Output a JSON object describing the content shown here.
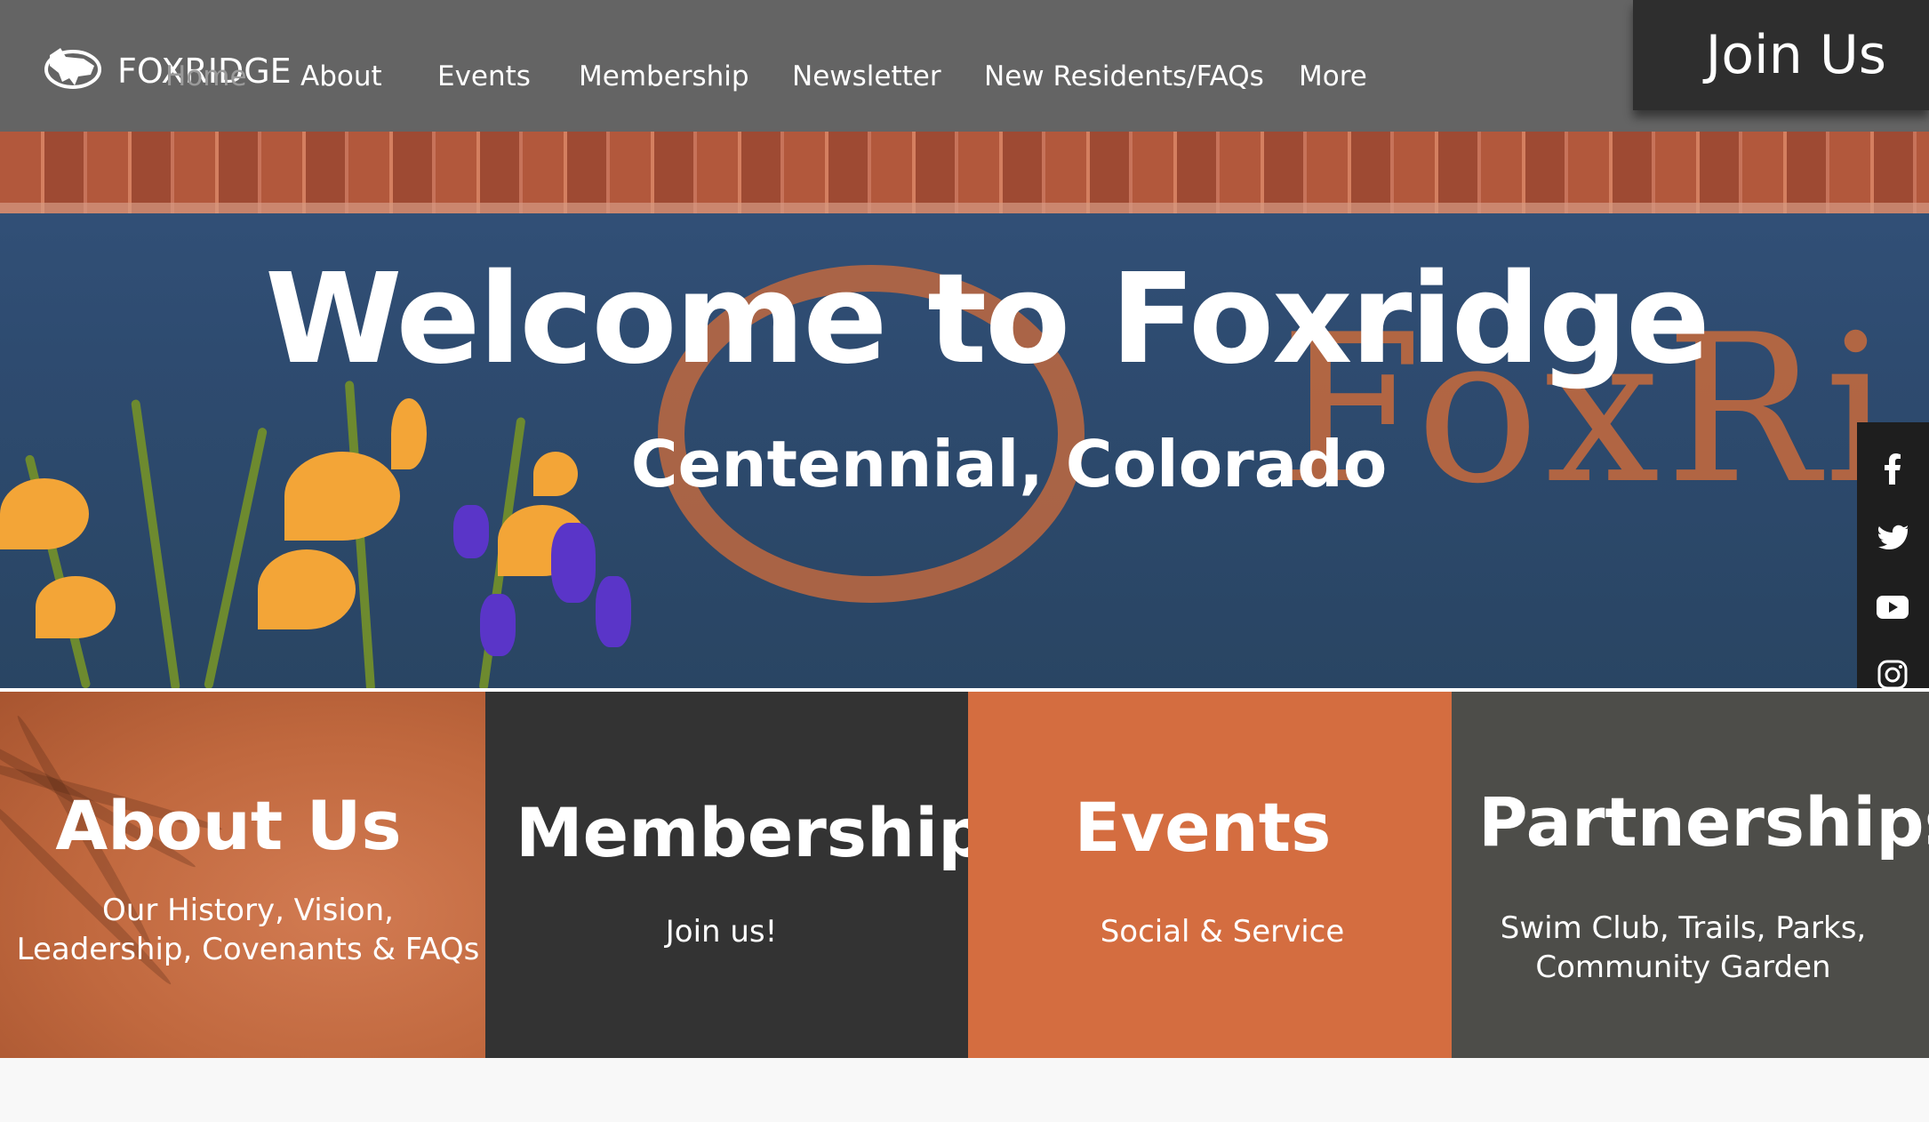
{
  "header": {
    "logo_text": "FOXRIDGE",
    "nav": [
      {
        "label": "Home"
      },
      {
        "label": "About"
      },
      {
        "label": "Events"
      },
      {
        "label": "Membership"
      },
      {
        "label": "Newsletter"
      },
      {
        "label": "New Residents/FAQs"
      },
      {
        "label": "More"
      }
    ],
    "join_label": "Join Us"
  },
  "hero": {
    "title": "Welcome to Foxridge",
    "subtitle": "Centennial, Colorado",
    "sign_text": "FoxRi"
  },
  "social": [
    {
      "icon": "facebook-icon"
    },
    {
      "icon": "twitter-icon"
    },
    {
      "icon": "youtube-icon"
    },
    {
      "icon": "instagram-icon"
    }
  ],
  "tiles": [
    {
      "title": "About Us",
      "text": "Our History, Vision, Leadership, Covenants & FAQs"
    },
    {
      "title": "Membership",
      "text": "Join us!"
    },
    {
      "title": "Events",
      "text": "Social & Service"
    },
    {
      "title": "Partnerships",
      "text": "Swim Club, Trails, Parks, Community Garden"
    }
  ],
  "colors": {
    "header_bg": "#646464",
    "join_bg": "#2e2e2e",
    "about_tile": "#c0683e",
    "membership_tile": "#333333",
    "events_tile": "#d46d40",
    "partnerships_tile": "#4d4d49"
  }
}
